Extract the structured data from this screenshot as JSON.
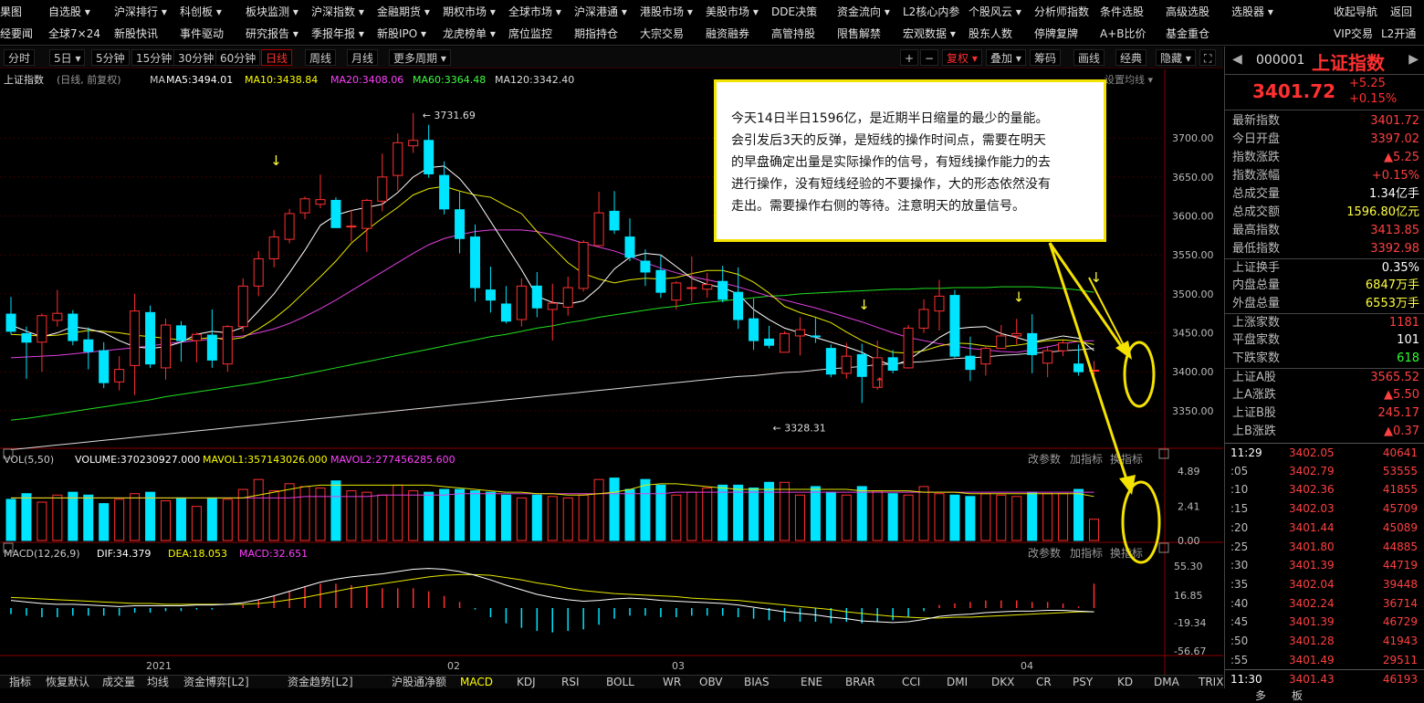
{
  "menu_row1": [
    "果图",
    "自选股 ▾",
    "沪深排行 ▾",
    "科创板 ▾",
    "板块监测 ▾",
    "沪深指数 ▾",
    "金融期货 ▾",
    "期权市场 ▾",
    "全球市场 ▾",
    "沪深港通 ▾",
    "港股市场 ▾",
    "美股市场 ▾",
    "DDE决策",
    "资金流向 ▾",
    "L2核心内参",
    "个股风云 ▾",
    "分析师指数",
    "条件选股",
    "高级选股",
    "选股器 ▾",
    "收起导航",
    "返回"
  ],
  "menu_row2": [
    "经要闻",
    "全球7×24",
    "新股快讯",
    "事件驱动",
    "研究报告 ▾",
    "季报年报 ▾",
    "新股IPO ▾",
    "龙虎榜单 ▾",
    "席位监控",
    "期指持仓",
    "大宗交易",
    "融资融券",
    "高管持股",
    "限售解禁",
    "宏观数据 ▾",
    "股东人数",
    "停牌复牌",
    "A+B比价",
    "基金重仓",
    "VIP交易",
    "L2开通"
  ],
  "timeframes": [
    "分时",
    "5日 ▾",
    "5分钟",
    "15分钟",
    "30分钟",
    "60分钟",
    "日线",
    "周线",
    "月线",
    "更多周期 ▾"
  ],
  "active_timeframe": "日线",
  "right_tools": [
    "+",
    "−",
    "复权 ▾",
    "叠加 ▾",
    "筹码",
    "画线",
    "经典",
    "隐藏 ▾",
    "⛶"
  ],
  "kline_header": {
    "name": "上证指数",
    "mode": "(日线, 前复权)",
    "ma_label": "MA",
    "ma5": "MA5:3494.01",
    "ma10": "MA10:3438.84",
    "ma20": "MA20:3408.06",
    "ma60": "MA60:3364.48",
    "ma120": "MA120:3342.40",
    "setting": "设置均线 ▾"
  },
  "vol_header": {
    "name": "VOL(5,50)",
    "volume": "VOLUME:370230927.000",
    "mavol1": "MAVOL1:357143026.000",
    "mavol2": "MAVOL2:277456285.600",
    "edit": "改参数",
    "add": "加指标",
    "swap": "换指标"
  },
  "macd_header": {
    "name": "MACD(12,26,9)",
    "dif": "DIF:34.379",
    "dea": "DEA:18.053",
    "macd": "MACD:32.651",
    "edit": "改参数",
    "add": "加指标",
    "swap": "换指标"
  },
  "price_axis": [
    "3700.00",
    "3650.00",
    "3600.00",
    "3550.00",
    "3500.00",
    "3450.00",
    "3400.00",
    "3350.00"
  ],
  "vol_axis": [
    "4.89",
    "2.41",
    "0.00"
  ],
  "macd_axis": [
    "55.30",
    "16.85",
    "-19.34",
    "-56.67"
  ],
  "time_axis": [
    "2021",
    "02",
    "03",
    "04"
  ],
  "high_label": "3731.69",
  "low_label": "3328.31",
  "annotation": [
    "今天14日半日1596亿，是近期半日缩量的最少的量能。",
    "会引发后3天的反弹，是短线的操作时间点，需要在明天",
    "的早盘确定出量是实际操作的信号，有短线操作能力的去",
    "进行操作，没有短线经验的不要操作，大的形态依然没有",
    "走出。需要操作右侧的等待。注意明天的放量信号。"
  ],
  "bottom_tabs": [
    "指标",
    "恢复默认",
    "成交量",
    "均线",
    "资金博弈[L2]",
    "资金趋势[L2]",
    "沪股通净额",
    "MACD",
    "KDJ",
    "RSI",
    "BOLL",
    "WR",
    "OBV",
    "BIAS",
    "ENE",
    "BRAR",
    "CCI",
    "DMI",
    "DKX",
    "CR",
    "PSY",
    "KD",
    "DMA",
    "TRIX",
    "更多",
    "模板"
  ],
  "side": {
    "code": "000001",
    "name": "上证指数",
    "price": "3401.72",
    "change": "+5.25",
    "pct": "+0.15%",
    "rows": [
      [
        "最新指数",
        "3401.72",
        "#ff4040"
      ],
      [
        "今日开盘",
        "3397.02",
        "#ff4040"
      ],
      [
        "指数涨跌",
        "▲5.25",
        "#ff4040"
      ],
      [
        "指数涨幅",
        "+0.15%",
        "#ff4040"
      ],
      [
        "总成交量",
        "1.34亿手",
        "#ffffff"
      ],
      [
        "总成交额",
        "1596.80亿元",
        "#ffff40"
      ],
      [
        "最高指数",
        "3413.85",
        "#ff4040"
      ],
      [
        "最低指数",
        "3392.98",
        "#ff4040"
      ],
      [
        "上证换手",
        "0.35%",
        "#ffffff"
      ],
      [
        "内盘总量",
        "6847万手",
        "#ffff40"
      ],
      [
        "外盘总量",
        "6553万手",
        "#ffff40"
      ],
      [
        "上涨家数",
        "1181",
        "#ff4040"
      ],
      [
        "平盘家数",
        "101",
        "#ffffff"
      ],
      [
        "下跌家数",
        "618",
        "#30ff30"
      ],
      [
        "上证A股",
        "3565.52",
        "#ff4040"
      ],
      [
        "上A涨跌",
        "▲5.50",
        "#ff4040"
      ],
      [
        "上证B股",
        "245.17",
        "#ff4040"
      ],
      [
        "上B涨跌",
        "▲0.37",
        "#ff4040"
      ]
    ],
    "ticks": [
      [
        "11:29",
        "3402.05",
        "40641"
      ],
      [
        ":05",
        "3402.79",
        "53555"
      ],
      [
        ":10",
        "3402.36",
        "41855"
      ],
      [
        ":15",
        "3402.03",
        "45709"
      ],
      [
        ":20",
        "3401.44",
        "45089"
      ],
      [
        ":25",
        "3401.80",
        "44885"
      ],
      [
        ":30",
        "3401.39",
        "44719"
      ],
      [
        ":35",
        "3402.04",
        "39448"
      ],
      [
        ":40",
        "3402.24",
        "36714"
      ],
      [
        ":45",
        "3401.39",
        "46729"
      ],
      [
        ":50",
        "3401.28",
        "41943"
      ],
      [
        ":55",
        "3401.49",
        "29511"
      ],
      [
        "11:30",
        "3401.43",
        "46193"
      ]
    ]
  },
  "chart_data": {
    "type": "candlestick",
    "ylim": [
      3310,
      3760
    ],
    "ohlc": [
      [
        3474,
        3496,
        3448,
        3452
      ],
      [
        3449,
        3458,
        3391,
        3438
      ],
      [
        3438,
        3475,
        3400,
        3472
      ],
      [
        3466,
        3505,
        3458,
        3475
      ],
      [
        3474,
        3479,
        3434,
        3440
      ],
      [
        3441,
        3457,
        3403,
        3426
      ],
      [
        3427,
        3438,
        3379,
        3386
      ],
      [
        3387,
        3420,
        3376,
        3403
      ],
      [
        3408,
        3500,
        3370,
        3478
      ],
      [
        3476,
        3485,
        3405,
        3410
      ],
      [
        3405,
        3468,
        3390,
        3460
      ],
      [
        3459,
        3465,
        3413,
        3440
      ],
      [
        3440,
        3450,
        3412,
        3448
      ],
      [
        3447,
        3480,
        3405,
        3415
      ],
      [
        3410,
        3460,
        3400,
        3458
      ],
      [
        3458,
        3520,
        3452,
        3510
      ],
      [
        3510,
        3555,
        3497,
        3545
      ],
      [
        3545,
        3582,
        3534,
        3573
      ],
      [
        3570,
        3609,
        3565,
        3603
      ],
      [
        3604,
        3625,
        3596,
        3622
      ],
      [
        3615,
        3653,
        3610,
        3621
      ],
      [
        3620,
        3624,
        3600,
        3585
      ],
      [
        3586,
        3608,
        3567,
        3587
      ],
      [
        3584,
        3622,
        3554,
        3620
      ],
      [
        3619,
        3680,
        3606,
        3650
      ],
      [
        3652,
        3706,
        3632,
        3694
      ],
      [
        3690,
        3732,
        3681,
        3697
      ],
      [
        3697,
        3717,
        3649,
        3654
      ],
      [
        3652,
        3670,
        3602,
        3609
      ],
      [
        3608,
        3631,
        3552,
        3571
      ],
      [
        3573,
        3589,
        3490,
        3508
      ],
      [
        3505,
        3535,
        3476,
        3492
      ],
      [
        3487,
        3510,
        3462,
        3465
      ],
      [
        3467,
        3520,
        3458,
        3510
      ],
      [
        3510,
        3528,
        3470,
        3482
      ],
      [
        3480,
        3513,
        3440,
        3488
      ],
      [
        3483,
        3522,
        3472,
        3508
      ],
      [
        3507,
        3569,
        3503,
        3566
      ],
      [
        3562,
        3631,
        3561,
        3604
      ],
      [
        3606,
        3632,
        3577,
        3582
      ],
      [
        3573,
        3597,
        3542,
        3547
      ],
      [
        3542,
        3557,
        3510,
        3528
      ],
      [
        3530,
        3550,
        3495,
        3502
      ],
      [
        3492,
        3516,
        3480,
        3514
      ],
      [
        3507,
        3548,
        3490,
        3508
      ],
      [
        3506,
        3527,
        3495,
        3512
      ],
      [
        3516,
        3536,
        3489,
        3493
      ],
      [
        3502,
        3534,
        3455,
        3467
      ],
      [
        3468,
        3494,
        3428,
        3440
      ],
      [
        3442,
        3459,
        3430,
        3434
      ],
      [
        3425,
        3452,
        3425,
        3449
      ],
      [
        3446,
        3470,
        3421,
        3454
      ],
      [
        3446,
        3469,
        3437,
        3445
      ],
      [
        3430,
        3435,
        3393,
        3397
      ],
      [
        3398,
        3437,
        3391,
        3420
      ],
      [
        3422,
        3436,
        3360,
        3394
      ],
      [
        3380,
        3440,
        3377,
        3418
      ],
      [
        3418,
        3428,
        3398,
        3402
      ],
      [
        3405,
        3460,
        3404,
        3456
      ],
      [
        3456,
        3493,
        3450,
        3480
      ],
      [
        3478,
        3518,
        3453,
        3497
      ],
      [
        3498,
        3505,
        3418,
        3420
      ],
      [
        3420,
        3445,
        3388,
        3403
      ],
      [
        3410,
        3432,
        3395,
        3430
      ],
      [
        3430,
        3460,
        3430,
        3446
      ],
      [
        3446,
        3468,
        3435,
        3449
      ],
      [
        3449,
        3474,
        3398,
        3422
      ],
      [
        3411,
        3433,
        3393,
        3427
      ],
      [
        3427,
        3440,
        3420,
        3437
      ],
      [
        3410,
        3435,
        3395,
        3400
      ],
      [
        3401,
        3414,
        3393,
        3402
      ]
    ],
    "ma5": [
      3460,
      3452,
      3445,
      3450,
      3458,
      3455,
      3450,
      3440,
      3432,
      3430,
      3432,
      3438,
      3448,
      3452,
      3450,
      3457,
      3478,
      3500,
      3527,
      3556,
      3588,
      3601,
      3607,
      3611,
      3615,
      3630,
      3650,
      3662,
      3664,
      3648,
      3624,
      3593,
      3562,
      3531,
      3497,
      3489,
      3487,
      3491,
      3508,
      3532,
      3547,
      3552,
      3550,
      3535,
      3520,
      3512,
      3508,
      3500,
      3480,
      3467,
      3456,
      3450,
      3444,
      3438,
      3432,
      3425,
      3415,
      3408,
      3415,
      3429,
      3444,
      3455,
      3457,
      3458,
      3449,
      3444,
      3438,
      3442,
      3446,
      3443,
      3427
    ],
    "ma10": [
      3448,
      3447,
      3446,
      3447,
      3450,
      3453,
      3452,
      3450,
      3447,
      3445,
      3443,
      3441,
      3442,
      3444,
      3441,
      3444,
      3455,
      3468,
      3484,
      3503,
      3522,
      3542,
      3565,
      3582,
      3597,
      3611,
      3627,
      3635,
      3638,
      3632,
      3627,
      3624,
      3613,
      3603,
      3580,
      3560,
      3540,
      3526,
      3519,
      3514,
      3518,
      3520,
      3519,
      3521,
      3526,
      3530,
      3530,
      3525,
      3515,
      3501,
      3484,
      3476,
      3470,
      3463,
      3451,
      3440,
      3432,
      3425,
      3424,
      3427,
      3433,
      3437,
      3436,
      3433,
      3432,
      3434,
      3437,
      3440,
      3441,
      3439,
      3435
    ],
    "ma20": [
      3418,
      3419,
      3420,
      3421,
      3423,
      3425,
      3427,
      3429,
      3431,
      3433,
      3436,
      3438,
      3440,
      3442,
      3444,
      3446,
      3450,
      3455,
      3462,
      3471,
      3481,
      3492,
      3504,
      3516,
      3528,
      3540,
      3552,
      3563,
      3571,
      3576,
      3580,
      3582,
      3582,
      3582,
      3580,
      3576,
      3571,
      3565,
      3560,
      3555,
      3548,
      3540,
      3533,
      3527,
      3522,
      3518,
      3514,
      3509,
      3503,
      3497,
      3492,
      3487,
      3482,
      3476,
      3470,
      3464,
      3457,
      3450,
      3444,
      3440,
      3436,
      3433,
      3430,
      3428,
      3426,
      3425,
      3428,
      3432,
      3436,
      3439,
      3440
    ],
    "ma60": [
      3338,
      3340,
      3343,
      3346,
      3349,
      3352,
      3355,
      3358,
      3361,
      3364,
      3368,
      3371,
      3374,
      3377,
      3380,
      3383,
      3386,
      3390,
      3393,
      3397,
      3401,
      3405,
      3409,
      3413,
      3417,
      3421,
      3425,
      3429,
      3433,
      3437,
      3441,
      3445,
      3448,
      3452,
      3456,
      3459,
      3463,
      3466,
      3470,
      3473,
      3476,
      3479,
      3482,
      3484,
      3487,
      3489,
      3491,
      3493,
      3495,
      3497,
      3498,
      3500,
      3501,
      3502,
      3503,
      3504,
      3505,
      3506,
      3506,
      3507,
      3507,
      3508,
      3508,
      3508,
      3509,
      3509,
      3509,
      3508,
      3507,
      3505,
      3502
    ],
    "ma120": [
      3300,
      3302,
      3304,
      3306,
      3308,
      3310,
      3312,
      3314,
      3316,
      3318,
      3320,
      3322,
      3324,
      3326,
      3328,
      3330,
      3332,
      3334,
      3336,
      3338,
      3340,
      3342,
      3344,
      3346,
      3348,
      3350,
      3352,
      3354,
      3356,
      3358,
      3360,
      3362,
      3364,
      3366,
      3368,
      3370,
      3372,
      3374,
      3376,
      3378,
      3380,
      3382,
      3384,
      3386,
      3388,
      3390,
      3392,
      3394,
      3395,
      3397,
      3399,
      3400,
      3402,
      3404,
      3405,
      3407,
      3409,
      3410,
      3412,
      3413,
      3415,
      3417,
      3418,
      3419,
      3421,
      3422,
      3424,
      3425,
      3427,
      3428,
      3430
    ],
    "volume": [
      2.9,
      3.3,
      2.7,
      3.2,
      3.4,
      3.2,
      2.6,
      2.9,
      3.3,
      3.4,
      2.8,
      3.0,
      2.4,
      3.0,
      2.9,
      3.6,
      4.3,
      3.5,
      4.0,
      3.8,
      3.7,
      4.2,
      3.5,
      3.4,
      3.2,
      3.9,
      3.5,
      3.4,
      3.6,
      3.6,
      3.5,
      3.4,
      3.2,
      3.0,
      3.2,
      3.1,
      3.0,
      3.2,
      4.3,
      4.4,
      3.6,
      4.3,
      3.9,
      3.2,
      3.4,
      3.7,
      3.9,
      3.9,
      3.7,
      4.1,
      4.1,
      3.2,
      3.8,
      3.4,
      3.2,
      3.8,
      3.5,
      3.3,
      3.2,
      3.8,
      3.3,
      3.2,
      3.1,
      3.3,
      3.2,
      3.1,
      3.4,
      3.3,
      3.3,
      3.6,
      1.5
    ],
    "mavol1": [
      3.0,
      3.0,
      3.0,
      3.0,
      3.0,
      3.0,
      3.0,
      3.0,
      3.0,
      3.0,
      3.0,
      3.0,
      3.0,
      3.0,
      3.0,
      3.0,
      3.2,
      3.4,
      3.6,
      3.8,
      3.9,
      3.9,
      3.9,
      3.9,
      3.9,
      3.9,
      3.9,
      3.9,
      3.8,
      3.7,
      3.6,
      3.5,
      3.4,
      3.4,
      3.3,
      3.3,
      3.2,
      3.2,
      3.3,
      3.4,
      3.6,
      3.9,
      4.0,
      4.0,
      3.9,
      3.8,
      3.7,
      3.6,
      3.6,
      3.6,
      3.6,
      3.6,
      3.6,
      3.6,
      3.6,
      3.5,
      3.5,
      3.5,
      3.5,
      3.4,
      3.4,
      3.4,
      3.3,
      3.3,
      3.3,
      3.3,
      3.3,
      3.3,
      3.3,
      3.3,
      3.1
    ],
    "mavol2": [
      3.0,
      3.0,
      3.0,
      3.0,
      3.0,
      3.0,
      3.0,
      3.0,
      3.0,
      3.0,
      3.0,
      3.0,
      3.0,
      3.0,
      3.0,
      3.0,
      3.0,
      3.0,
      3.0,
      3.1,
      3.1,
      3.1,
      3.1,
      3.1,
      3.2,
      3.2,
      3.2,
      3.2,
      3.2,
      3.3,
      3.3,
      3.3,
      3.3,
      3.3,
      3.3,
      3.3,
      3.3,
      3.3,
      3.3,
      3.3,
      3.3,
      3.3,
      3.3,
      3.4,
      3.4,
      3.4,
      3.4,
      3.4,
      3.4,
      3.4,
      3.4,
      3.4,
      3.4,
      3.4,
      3.4,
      3.4,
      3.4,
      3.4,
      3.4,
      3.4,
      3.4,
      3.4,
      3.4,
      3.4,
      3.4,
      3.4,
      3.4,
      3.4,
      3.4,
      3.4,
      3.4
    ],
    "dif": [
      10,
      8,
      6,
      5,
      5,
      4,
      3,
      2,
      3,
      3,
      3,
      3,
      4,
      4,
      5,
      7,
      11,
      16,
      22,
      28,
      34,
      38,
      41,
      43,
      45,
      48,
      51,
      52,
      51,
      48,
      43,
      37,
      30,
      24,
      18,
      14,
      11,
      9,
      10,
      12,
      13,
      12,
      10,
      9,
      8,
      7,
      6,
      4,
      1,
      -2,
      -5,
      -7,
      -9,
      -12,
      -14,
      -17,
      -18,
      -19,
      -18,
      -15,
      -11,
      -9,
      -8,
      -6,
      -5,
      -4,
      -4,
      -3,
      -3,
      -4,
      -5
    ],
    "dea": [
      14,
      13,
      12,
      11,
      10,
      9,
      8,
      7,
      6,
      6,
      5,
      5,
      5,
      5,
      5,
      5,
      6,
      8,
      11,
      14,
      18,
      22,
      26,
      29,
      32,
      35,
      38,
      41,
      43,
      44,
      44,
      43,
      40,
      37,
      33,
      30,
      26,
      23,
      21,
      19,
      18,
      17,
      16,
      15,
      13,
      12,
      11,
      10,
      8,
      6,
      4,
      2,
      0,
      -2,
      -5,
      -7,
      -9,
      -11,
      -12,
      -13,
      -13,
      -12,
      -12,
      -11,
      -10,
      -9,
      -8,
      -7,
      -6,
      -5,
      -5
    ],
    "macd": [
      -8,
      -10,
      -12,
      -12,
      -10,
      -10,
      -10,
      -10,
      -6,
      -6,
      -4,
      -4,
      -2,
      -2,
      0,
      4,
      10,
      16,
      22,
      28,
      32,
      32,
      30,
      28,
      26,
      26,
      26,
      22,
      16,
      8,
      -2,
      -12,
      -20,
      -26,
      -30,
      -32,
      -30,
      -28,
      -22,
      -14,
      -10,
      -10,
      -12,
      -12,
      -10,
      -10,
      -10,
      -12,
      -14,
      -16,
      -18,
      -18,
      -18,
      -20,
      -18,
      -20,
      -18,
      -16,
      -12,
      -4,
      4,
      6,
      8,
      10,
      10,
      10,
      8,
      8,
      6,
      2,
      32
    ]
  }
}
